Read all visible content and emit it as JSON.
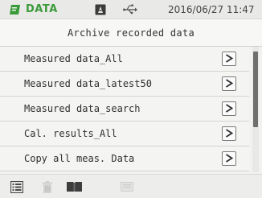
{
  "status": {
    "mode_label": "DATA",
    "datetime": "2016/06/27 11:47",
    "icons": [
      "data-mode-icon",
      "storage-icon",
      "usb-icon"
    ]
  },
  "header": {
    "title": "Archive recorded data"
  },
  "menu": {
    "items": [
      {
        "label": "Measured data_All",
        "arrow": ">"
      },
      {
        "label": "Measured data_latest50",
        "arrow": ">"
      },
      {
        "label": "Measured data_search",
        "arrow": ">"
      },
      {
        "label": "Cal. results_All",
        "arrow": ">"
      },
      {
        "label": "Copy all meas. Data",
        "arrow": ">"
      }
    ]
  },
  "toolbar": {
    "icons": [
      "list-view-icon",
      "trash-icon",
      "book-icon",
      "disabled-icon"
    ]
  },
  "colors": {
    "mode_green": "#3a9a3a",
    "text": "#2f2f2f",
    "button_border": "#7a7a7a",
    "scroll_thumb": "#6f6f6f"
  }
}
